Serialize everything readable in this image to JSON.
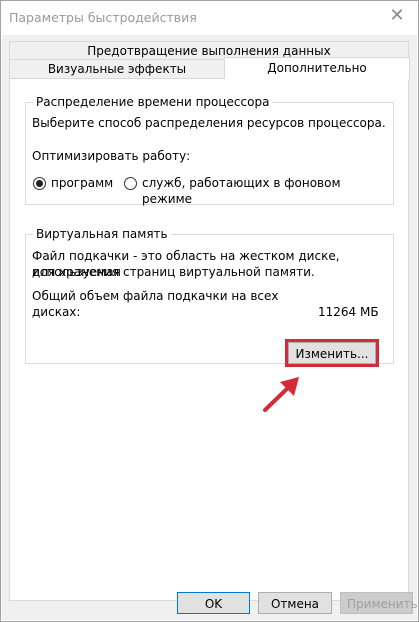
{
  "window": {
    "title": "Параметры быстродействия",
    "close_symbol": "✕"
  },
  "tabs": {
    "dep": "Предотвращение выполнения данных",
    "visual": "Визуальные эффекты",
    "advanced": "Дополнительно",
    "active": "advanced"
  },
  "cpu_group": {
    "title": "Распределение времени процессора",
    "description": "Выберите способ распределения ресурсов процессора.",
    "optimize_label": "Оптимизировать работу:",
    "option_programs": "программ",
    "option_services": "служб, работающих в фоновом режиме",
    "selected": "programs"
  },
  "vm_group": {
    "title": "Виртуальная память",
    "description_line1": "Файл подкачки - это область на жестком диске, используемая",
    "description_line2": "для хранения страниц виртуальной памяти.",
    "total_line1": "Общий объем файла подкачки на всех",
    "total_line2": "дисках:",
    "total_value": "11264 МБ",
    "change_button": "Изменить..."
  },
  "footer": {
    "ok": "OK",
    "cancel": "Отмена",
    "apply": "Применить"
  },
  "colors": {
    "highlight": "#d42a3a",
    "default_button_border": "#0078d7"
  }
}
